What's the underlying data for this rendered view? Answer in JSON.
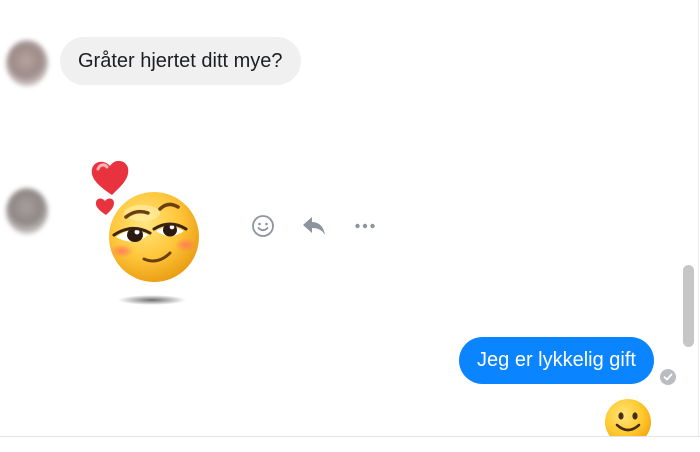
{
  "messages": {
    "incoming_text": "Gråter hjertet ditt mye?",
    "outgoing_text": "Jeg er lykkelig gift"
  },
  "icons": {
    "sticker": "blushing-emoji-hearts-sticker",
    "react": "smiley-face-icon",
    "reply": "reply-arrow-icon",
    "more": "more-dots-icon",
    "delivered": "check-circle-icon",
    "seen": "smiling-face-emoji"
  },
  "colors": {
    "incoming_bubble": "#f0f0f0",
    "outgoing_bubble": "#0b84ff",
    "outgoing_text": "#ffffff",
    "icon_grey": "#8d949e"
  }
}
